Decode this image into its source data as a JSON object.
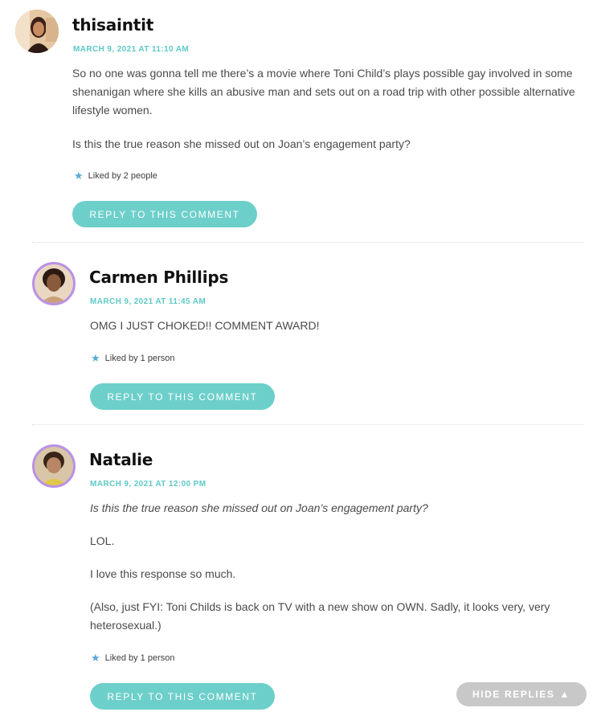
{
  "comments": [
    {
      "author": "thisaintit",
      "timestamp": "MARCH 9, 2021 AT 11:10 AM",
      "paragraphs": [
        "So no one was gonna tell me there’s a movie where Toni Child’s plays possible gay involved in some shenanigan where she kills an abusive man and sets out on a road trip with other possible alternative lifestyle women.",
        "Is this the true reason she missed out on Joan’s engagement party?"
      ],
      "likes": "Liked by 2 people",
      "reply_label": "REPLY TO THIS COMMENT"
    },
    {
      "author": "Carmen Phillips",
      "timestamp": "MARCH 9, 2021 AT 11:45 AM",
      "paragraphs": [
        "OMG I JUST CHOKED!! COMMENT AWARD!"
      ],
      "likes": "Liked by 1 person",
      "reply_label": "REPLY TO THIS COMMENT"
    },
    {
      "author": "Natalie",
      "timestamp": "MARCH 9, 2021 AT 12:00 PM",
      "quote": "Is this the true reason she missed out on Joan’s engagement party?",
      "paragraphs": [
        "LOL.",
        "I love this response so much.",
        "(Also, just FYI: Toni Childs is back on TV with a new show on OWN. Sadly, it looks very, very heterosexual.)"
      ],
      "likes": "Liked by 1 person",
      "reply_label": "REPLY TO THIS COMMENT"
    }
  ],
  "hide_replies_label": "HIDE REPLIES",
  "icons": {
    "like": "star-icon",
    "hide": "triangle-up-icon"
  },
  "colors": {
    "accent": "#6dcfca",
    "timestamp": "#5ec9c6",
    "avatar_ring": "#b991e6",
    "star": "#5aa9d6",
    "hide_button": "#c8c8c8"
  }
}
